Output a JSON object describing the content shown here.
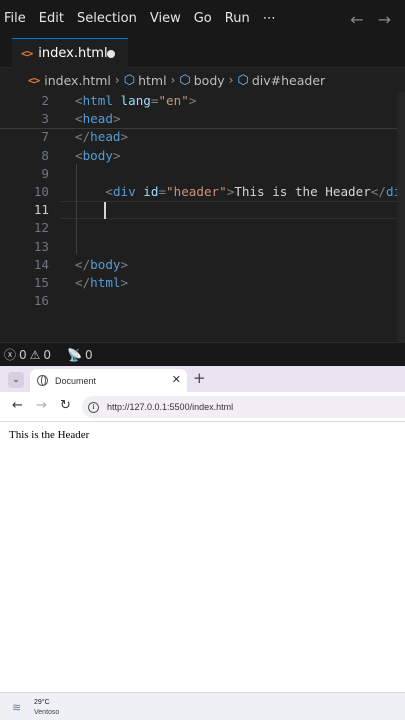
{
  "editor": {
    "menu": [
      "File",
      "Edit",
      "Selection",
      "View",
      "Go",
      "Run",
      "⋯"
    ],
    "nav": {
      "back": "←",
      "forward": "→"
    },
    "tab": {
      "icon": "<>",
      "label": "index.html"
    },
    "breadcrumb": [
      "index.html",
      "html",
      "body",
      "div#header"
    ],
    "lines": [
      {
        "n": "2",
        "code": [
          [
            "punct",
            "<"
          ],
          [
            "tag",
            "html"
          ],
          [
            "txt",
            " "
          ],
          [
            "attr",
            "lang"
          ],
          [
            "punct",
            "="
          ],
          [
            "str",
            "\"en\""
          ],
          [
            "punct",
            ">"
          ]
        ]
      },
      {
        "n": "3",
        "code": [
          [
            "punct",
            "<"
          ],
          [
            "tag",
            "head"
          ],
          [
            "punct",
            ">"
          ]
        ]
      },
      {
        "n": "7",
        "code": [
          [
            "punct",
            "</"
          ],
          [
            "tag",
            "head"
          ],
          [
            "punct",
            ">"
          ]
        ]
      },
      {
        "n": "8",
        "code": [
          [
            "punct",
            "<"
          ],
          [
            "tag",
            "body"
          ],
          [
            "punct",
            ">"
          ]
        ]
      },
      {
        "n": "9",
        "code": []
      },
      {
        "n": "10",
        "code": [
          [
            "txt",
            "    "
          ],
          [
            "punct",
            "<"
          ],
          [
            "tag",
            "div"
          ],
          [
            "txt",
            " "
          ],
          [
            "attr",
            "id"
          ],
          [
            "punct",
            "="
          ],
          [
            "str",
            "\"header\""
          ],
          [
            "punct",
            ">"
          ],
          [
            "txt",
            "This is the Header"
          ],
          [
            "punct",
            "</"
          ],
          [
            "tag",
            "div"
          ],
          [
            "punct",
            ">"
          ]
        ]
      },
      {
        "n": "11",
        "code": [],
        "active": true
      },
      {
        "n": "12",
        "code": []
      },
      {
        "n": "13",
        "code": []
      },
      {
        "n": "14",
        "code": [
          [
            "punct",
            "</"
          ],
          [
            "tag",
            "body"
          ],
          [
            "punct",
            ">"
          ]
        ]
      },
      {
        "n": "15",
        "code": [
          [
            "punct",
            "</"
          ],
          [
            "tag",
            "html"
          ],
          [
            "punct",
            ">"
          ]
        ]
      },
      {
        "n": "16",
        "code": []
      }
    ],
    "status": {
      "errors": "0",
      "warnings": "0",
      "ports": "0"
    }
  },
  "browser": {
    "tab_title": "Document",
    "close": "✕",
    "new_tab": "+",
    "url": "http://127.0.0.1:5500/index.html",
    "page_text": "This is the Header"
  },
  "taskbar": {
    "temperature": "29°C",
    "condition": "Ventoso"
  },
  "colors": {
    "tag": "#569cd6",
    "attr": "#9cdcfe",
    "string": "#ce9178",
    "html_icon": "#e37933",
    "tab_accent": "#0078d4"
  }
}
